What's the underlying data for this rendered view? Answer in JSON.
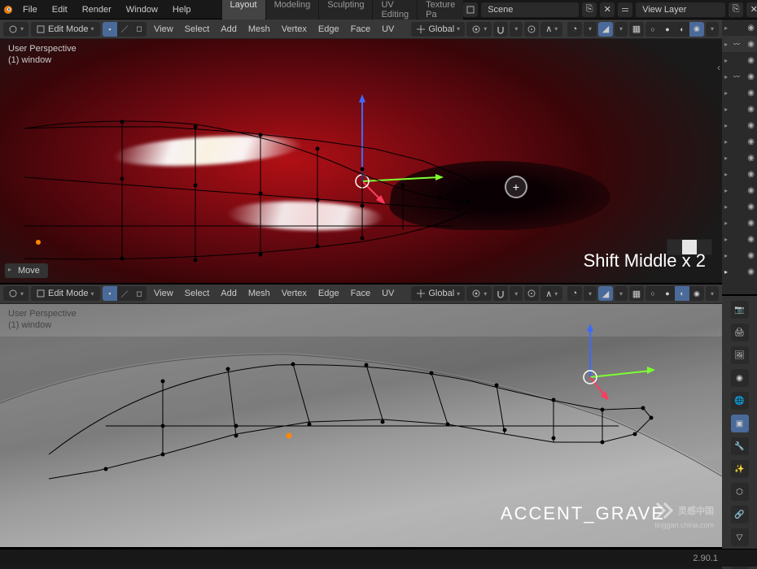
{
  "topmenu": [
    "File",
    "Edit",
    "Render",
    "Window",
    "Help"
  ],
  "workspaces": [
    "Layout",
    "Modeling",
    "Sculpting",
    "UV Editing",
    "Texture Pa"
  ],
  "workspace_active": 0,
  "scene_label": "Scene",
  "layer_label": "View Layer",
  "mode": "Edit Mode",
  "view_menus": [
    "View",
    "Select",
    "Add",
    "Mesh",
    "Vertex",
    "Edge",
    "Face",
    "UV"
  ],
  "orientation": "Global",
  "overlay": {
    "perspective": "User Perspective",
    "object": "(1) window"
  },
  "status_op": "Move",
  "annotation_top": "Shift Middle x 2",
  "annotation_bot": "ACCENT_GRAVE",
  "watermark": "灵感中国",
  "watermark_sub": "linggan.china.com",
  "version": "2.90.1",
  "outliner_eye": "◉"
}
